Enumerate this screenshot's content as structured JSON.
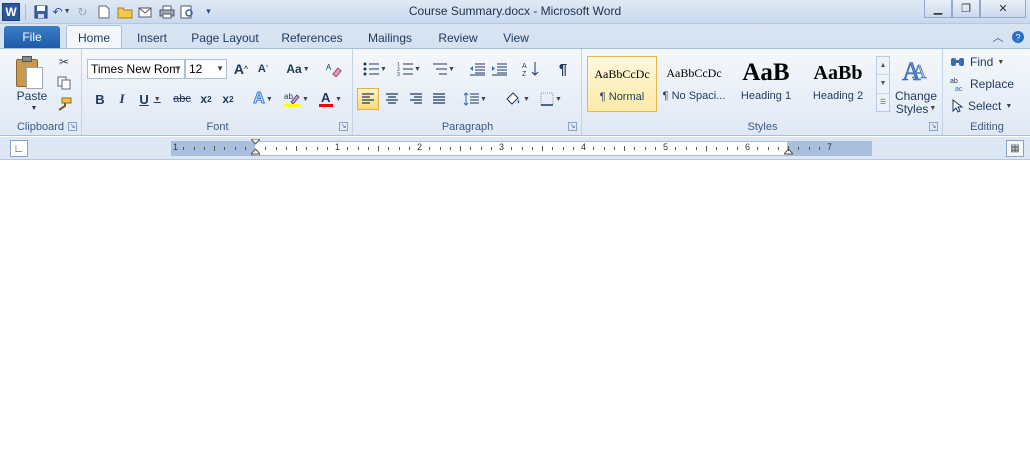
{
  "window": {
    "title": "Course Summary.docx  -  Microsoft Word"
  },
  "quick_access": {
    "items": [
      "word-logo-icon",
      "save-icon",
      "undo-icon",
      "redo-icon",
      "new-document-icon",
      "open-icon",
      "email-icon",
      "print-icon",
      "print-preview-icon",
      "customize-icon"
    ],
    "logo_letter": "W"
  },
  "tabs": [
    {
      "label": "File"
    },
    {
      "label": "Home"
    },
    {
      "label": "Insert"
    },
    {
      "label": "Page Layout"
    },
    {
      "label": "References"
    },
    {
      "label": "Mailings"
    },
    {
      "label": "Review"
    },
    {
      "label": "View"
    }
  ],
  "clipboard": {
    "label": "Clipboard",
    "paste": "Paste"
  },
  "font": {
    "label": "Font",
    "family": "Times New Rom",
    "size": "12"
  },
  "paragraph": {
    "label": "Paragraph"
  },
  "styles": {
    "label": "Styles",
    "items": [
      {
        "preview": "AaBbCcDc",
        "name": "¶ Normal"
      },
      {
        "preview": "AaBbCcDc",
        "name": "¶ No Spaci..."
      },
      {
        "preview": "AaB",
        "name": "Heading 1"
      },
      {
        "preview": "AaBb",
        "name": "Heading 2"
      }
    ],
    "change_styles": "Change",
    "change_styles_2": "Styles"
  },
  "editing": {
    "label": "Editing",
    "find": "Find",
    "replace": "Replace",
    "select": "Select"
  },
  "ruler": {
    "numbers": [
      "1",
      "1",
      "2",
      "3",
      "4",
      "5",
      "6",
      "7"
    ]
  },
  "colors": {
    "accent": "#2b5797",
    "highlight": "#ffff00",
    "font_color": "#ff0000"
  }
}
